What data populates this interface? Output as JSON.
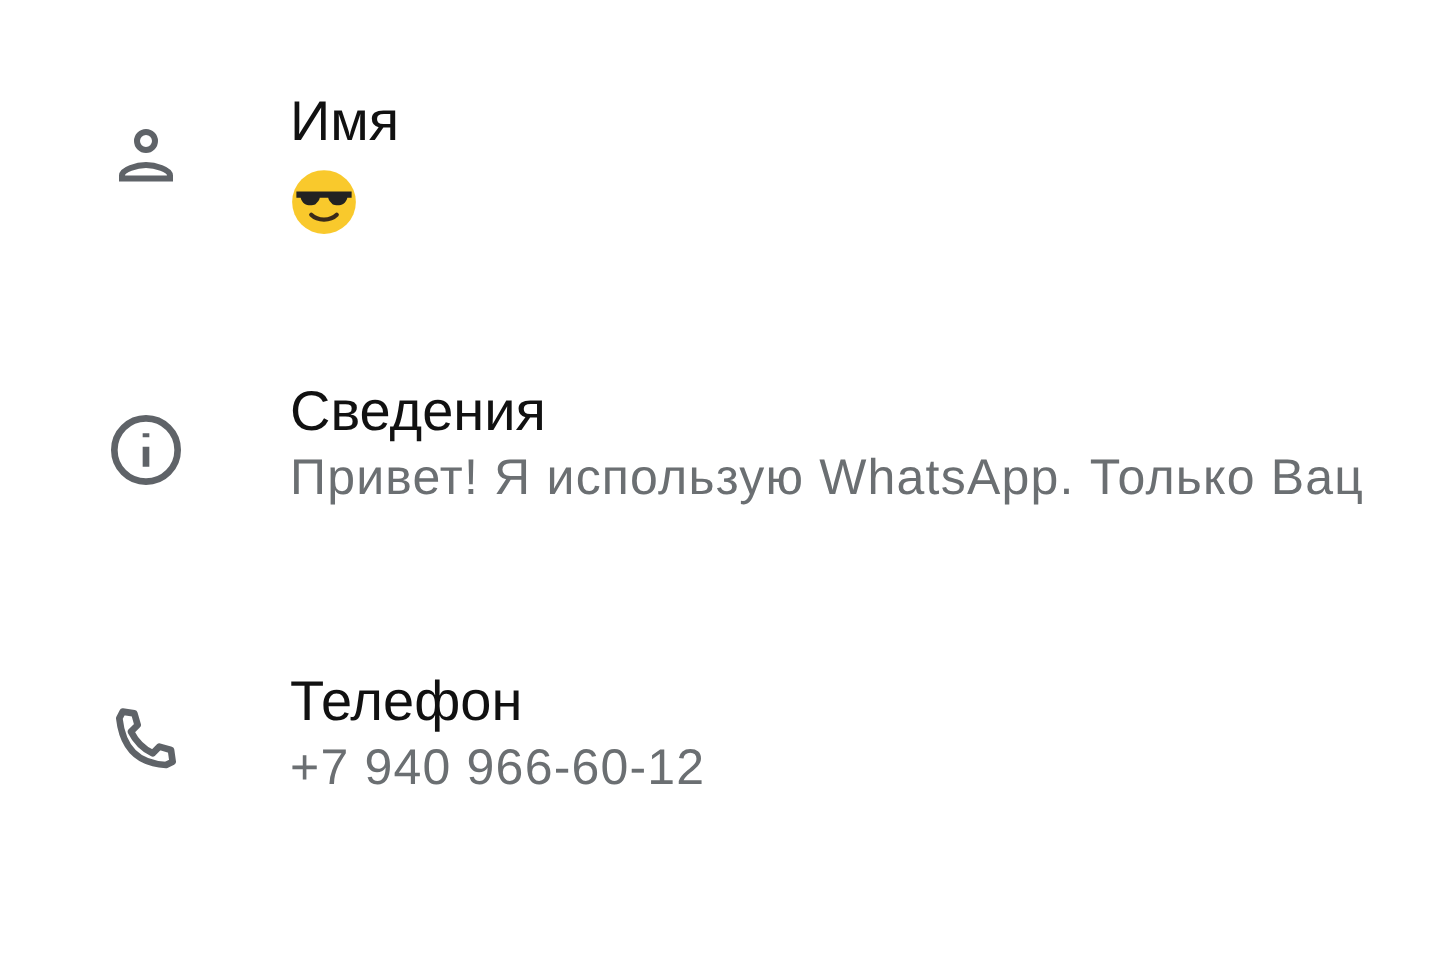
{
  "rows": [
    {
      "kind": "name",
      "label": "Имя"
    },
    {
      "kind": "about",
      "label": "Сведения",
      "value": "Привет! Я использую WhatsApp. Только Вац"
    },
    {
      "kind": "phone",
      "label": "Телефон",
      "value": "+7 940 966-60-12"
    }
  ]
}
